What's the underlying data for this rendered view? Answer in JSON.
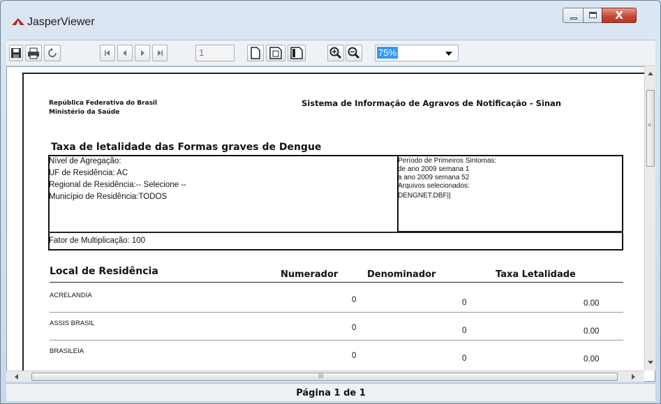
{
  "window": {
    "title": "JasperViewer",
    "close_glyph": "X"
  },
  "toolbar": {
    "buttons": [
      "save-icon",
      "print-icon",
      "reload-icon",
      "first-page-icon",
      "previous-page-icon",
      "next-page-icon",
      "last-page-icon",
      "actual-size-icon",
      "fit-page-icon",
      "fit-width-icon",
      "zoom-in-icon",
      "zoom-out-icon"
    ],
    "page_number": "1",
    "zoom_value": "75%"
  },
  "report": {
    "header_left_line1": "República Federativa do Brasil",
    "header_left_line2": "Ministério da Saúde",
    "header_right": "Sistema de Informação de Agravos de Notificação - Sinan",
    "title": "Taxa de letalidade das Formas graves de Dengue",
    "params_left": [
      "Nível de Agregação:",
      "UF de Residência: AC",
      "Regional de Residência:-- Selecione --",
      "Município de Residência:TODOS"
    ],
    "params_right": [
      "Período de Primeiros Sintomas:",
      "de ano 2009 semana 1",
      "a ano 2009 semana 52",
      "Arquivos selecionados:",
      "DENGNET.DBF||"
    ],
    "factor": "Fator de Multiplicação: 100",
    "columns": {
      "local": "Local de Residência",
      "numerador": "Numerador",
      "denominador": "Denominador",
      "taxa": "Taxa Letalidade"
    },
    "rows": [
      {
        "name": "ACRELANDIA",
        "numerador": "0",
        "denominador": "0",
        "taxa": "0.00"
      },
      {
        "name": "ASSIS BRASIL",
        "numerador": "0",
        "denominador": "0",
        "taxa": "0.00"
      },
      {
        "name": "BRASILEIA",
        "numerador": "0",
        "denominador": "0",
        "taxa": "0.00"
      }
    ]
  },
  "scrollbar": {
    "h_grip": "III",
    "v_grip": "≡"
  },
  "status": {
    "page_label": "Página 1 de 1"
  }
}
